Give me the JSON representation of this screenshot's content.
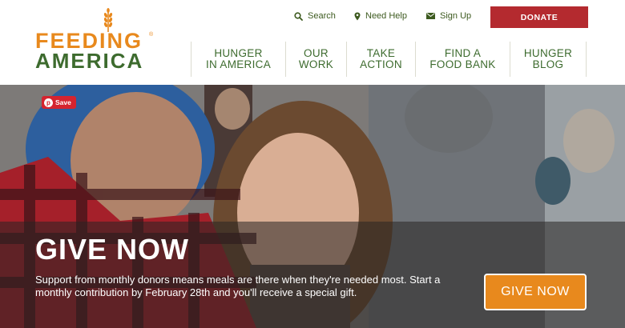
{
  "logo": {
    "line1": "FEEDING",
    "line2": "AMERICA",
    "reg": "®"
  },
  "utility": {
    "search": "Search",
    "help": "Need Help",
    "signup": "Sign Up",
    "donate": "DONATE"
  },
  "nav": [
    {
      "label": "HUNGER\nIN AMERICA"
    },
    {
      "label": "OUR\nWORK"
    },
    {
      "label": "TAKE\nACTION"
    },
    {
      "label": "FIND A\nFOOD BANK"
    },
    {
      "label": "HUNGER\nBLOG"
    }
  ],
  "hero": {
    "save_label": "Save",
    "title": "GIVE NOW",
    "text": "Support from monthly donors means meals are there when they're needed most. Start a monthly contribution by February 28th and you'll receive a special gift.",
    "button": "GIVE NOW"
  },
  "colors": {
    "brand_orange": "#e8891d",
    "brand_green": "#3d6b2e",
    "donate_red": "#b42a2f",
    "pinterest_red": "#d5242f"
  }
}
